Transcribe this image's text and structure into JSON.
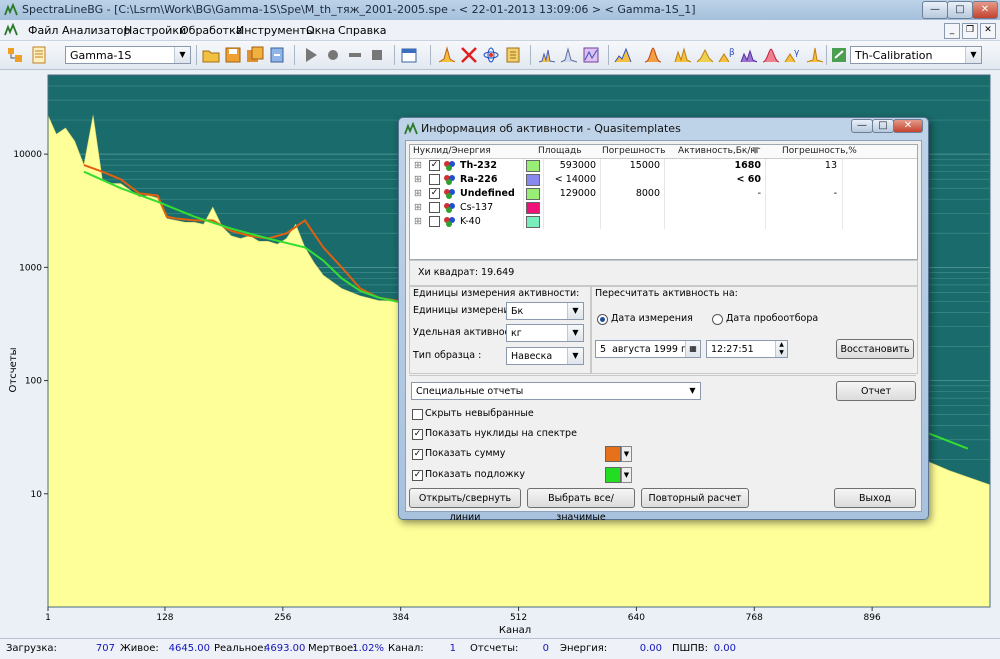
{
  "window": {
    "title": "SpectraLineBG - [C:\\Lsrm\\Work\\BG\\Gamma-1S\\Spe\\M_th_тяж_2001-2005.spe - < 22-01-2013 13:09:06 > < Gamma-1S_1]",
    "minimize_label": "—",
    "maximize_label": "□",
    "close_label": "✕"
  },
  "menu": [
    "Файл",
    "Анализатор",
    "Настройки",
    "Обработка",
    "Инструменты",
    "Окна",
    "Справка"
  ],
  "toolbar": {
    "analyzer_combo": "Gamma-1S",
    "calibration_combo": "Th-Calibration"
  },
  "plot": {
    "ylabel": "Отсчеты",
    "xlabel": "Канал",
    "y_ticks": [
      "10000",
      "1000",
      "100",
      "10"
    ],
    "x_ticks": [
      "1",
      "128",
      "256",
      "384",
      "512",
      "640",
      "768",
      "896"
    ]
  },
  "chart_data": {
    "type": "line",
    "xlabel": "Канал",
    "ylabel": "Отсчеты",
    "y_scale": "log",
    "xlim": [
      1,
      1024
    ],
    "ylim": [
      1,
      50000
    ],
    "series": [
      {
        "kind": "spectrum",
        "color": "#ffff99",
        "x": [
          1,
          10,
          20,
          30,
          40,
          50,
          60,
          70,
          80,
          90,
          100,
          110,
          120,
          130,
          140,
          150,
          160,
          170,
          180,
          190,
          200,
          210,
          220,
          230,
          240,
          250,
          260,
          270,
          280,
          290,
          300,
          320,
          340,
          360,
          384,
          420,
          460,
          512,
          560,
          620,
          680,
          740,
          800,
          860,
          900,
          940,
          980,
          1024
        ],
        "y": [
          22000,
          15000,
          17000,
          13000,
          8000,
          22000,
          6000,
          5500,
          5500,
          4800,
          4200,
          4300,
          4100,
          2700,
          2600,
          2500,
          2500,
          2400,
          3400,
          2300,
          1900,
          1800,
          1900,
          1700,
          1700,
          1600,
          1800,
          2400,
          1500,
          1100,
          850,
          650,
          560,
          510,
          500,
          480,
          470,
          450,
          400,
          330,
          220,
          130,
          70,
          40,
          30,
          22,
          16,
          12
        ]
      },
      {
        "kind": "sum",
        "color": "#e06010",
        "x": [
          40,
          60,
          80,
          100,
          120,
          130,
          140,
          160,
          180,
          200,
          220,
          240,
          260,
          280,
          300,
          320,
          340,
          360,
          384
        ],
        "y": [
          8000,
          7000,
          6000,
          4500,
          4300,
          2800,
          2700,
          2600,
          2600,
          2100,
          1900,
          1800,
          2000,
          2600,
          1500,
          1000,
          650,
          540,
          500
        ]
      },
      {
        "kind": "background",
        "color": "#33dd33",
        "x": [
          40,
          80,
          120,
          160,
          200,
          240,
          280,
          300,
          320,
          340,
          360,
          384,
          430,
          480,
          530,
          600,
          680,
          760,
          840,
          920,
          1000
        ],
        "y": [
          7000,
          5000,
          3800,
          2800,
          2200,
          1800,
          1500,
          1150,
          800,
          620,
          540,
          490,
          460,
          430,
          400,
          340,
          230,
          140,
          80,
          45,
          25
        ]
      }
    ]
  },
  "status": {
    "load_label": "Загрузка:",
    "load_value": "707",
    "live_label": "Живое:",
    "live_value": "4645.00",
    "real_label": "Реальное:",
    "real_value": "4693.00",
    "dead_label": "Мертвое:",
    "dead_value": "1.02%",
    "channel_label": "Канал:",
    "channel_value": "1",
    "counts_label": "Отсчеты:",
    "counts_value": "0",
    "energy_label": "Энергия:",
    "energy_value": "0.00",
    "fwhm_label": "ПШПВ:",
    "fwhm_value": "0.00"
  },
  "dialog": {
    "title": "Информация об активности - Quasitemplates",
    "headers": {
      "nuclide": "Нуклид/Энергия",
      "area": "Площадь",
      "error": "Погрешность",
      "activity": "Активность,Бк/кг",
      "error_pct": "Погрешность,%"
    },
    "rows": [
      {
        "expand": "⊞",
        "checked": "✓",
        "name": "Th-232",
        "color": "#99ee77",
        "area": "593000",
        "error": "15000",
        "activity": "1680",
        "error_pct": "13",
        "bold": true
      },
      {
        "expand": "⊞",
        "checked": "",
        "name": "Ra-226",
        "color": "#8888ee",
        "area": "< 14000",
        "error": "",
        "activity": "< 60",
        "error_pct": "",
        "bold": true
      },
      {
        "expand": "⊞",
        "checked": "✓",
        "name": "Undefined",
        "color": "#99ee77",
        "area": "129000",
        "error": "8000",
        "activity": "-",
        "error_pct": "-",
        "bold": true
      },
      {
        "expand": "⊞",
        "checked": "",
        "name": "Cs-137",
        "color": "#ee1177",
        "area": "",
        "error": "",
        "activity": "",
        "error_pct": "",
        "bold": false
      },
      {
        "expand": "⊞",
        "checked": "",
        "name": "K-40",
        "color": "#77eebb",
        "area": "",
        "error": "",
        "activity": "",
        "error_pct": "",
        "bold": false
      }
    ],
    "chi_square": "Хи квадрат: 19.649",
    "units_group": "Единицы измерения активности:",
    "units_label": "Единицы измерения :",
    "units_value": "Бк",
    "specific_label": "Удельная активность :",
    "specific_value": "кг",
    "sample_type_label": "Тип образца :",
    "sample_type_value": "Навеска",
    "recalc_group": "Пересчитать активность на:",
    "radio_measure": "Дата измерения",
    "radio_sampling": "Дата пробоотбора",
    "date_day": "5",
    "date_month": "августа",
    "date_year": "1999 г.",
    "time_value": "12:27:51",
    "restore_button": "Восстановить",
    "special_reports": "Специальные отчеты",
    "report_button": "Отчет",
    "hide_unselected": "Скрыть невыбранные",
    "show_nuclides": "Показать нуклиды на спектре",
    "show_sum": "Показать сумму",
    "sum_color": "#e8701a",
    "show_background": "Показать подложку",
    "background_color": "#22dd22",
    "toggle_lines_button": "Открыть/свернуть линии",
    "select_button": "Выбрать все/значимые",
    "recalc_button": "Повторный расчет",
    "exit_button": "Выход"
  }
}
